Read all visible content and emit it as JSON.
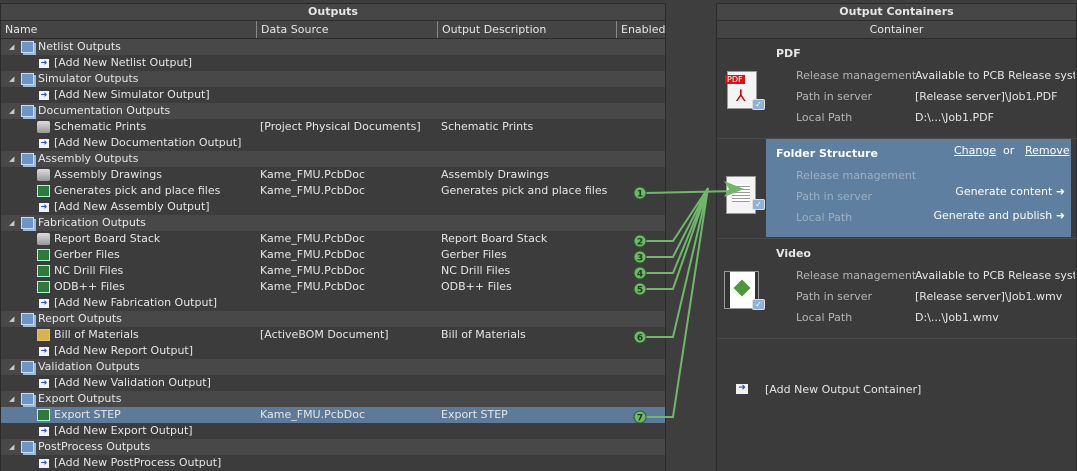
{
  "outputs": {
    "title": "Outputs",
    "columns": [
      "Name",
      "Data Source",
      "Output Description",
      "Enabled"
    ],
    "rows": [
      {
        "type": "group",
        "name": "Netlist Outputs"
      },
      {
        "type": "add",
        "name": "[Add New Netlist Output]"
      },
      {
        "type": "group",
        "name": "Simulator Outputs"
      },
      {
        "type": "add",
        "name": "[Add New Simulator Output]"
      },
      {
        "type": "group",
        "name": "Documentation Outputs"
      },
      {
        "type": "item",
        "icon": "printer-icon",
        "name": "Schematic Prints",
        "source": "[Project Physical Documents]",
        "desc": "Schematic Prints"
      },
      {
        "type": "add",
        "name": "[Add New Documentation Output]"
      },
      {
        "type": "group",
        "name": "Assembly Outputs"
      },
      {
        "type": "item",
        "icon": "printer-icon",
        "name": "Assembly Drawings",
        "source": "Kame_FMU.PcbDoc",
        "desc": "Assembly Drawings"
      },
      {
        "type": "item",
        "icon": "pcb-icon",
        "name": "Generates pick and place files",
        "source": "Kame_FMU.PcbDoc",
        "desc": "Generates pick and place files",
        "enabled": "1"
      },
      {
        "type": "add",
        "name": "[Add New Assembly Output]"
      },
      {
        "type": "group",
        "name": "Fabrication Outputs"
      },
      {
        "type": "item",
        "icon": "printer-icon",
        "name": "Report Board Stack",
        "source": "Kame_FMU.PcbDoc",
        "desc": "Report Board Stack",
        "enabled": "2"
      },
      {
        "type": "item",
        "icon": "pcb-icon",
        "name": "Gerber Files",
        "source": "Kame_FMU.PcbDoc",
        "desc": "Gerber Files",
        "enabled": "3"
      },
      {
        "type": "item",
        "icon": "pcb-icon",
        "name": "NC Drill Files",
        "source": "Kame_FMU.PcbDoc",
        "desc": "NC Drill Files",
        "enabled": "4"
      },
      {
        "type": "item",
        "icon": "pcb-icon",
        "name": "ODB++ Files",
        "source": "Kame_FMU.PcbDoc",
        "desc": "ODB++ Files",
        "enabled": "5"
      },
      {
        "type": "add",
        "name": "[Add New Fabrication Output]"
      },
      {
        "type": "group",
        "name": "Report Outputs"
      },
      {
        "type": "item",
        "icon": "bom-icon",
        "name": "Bill of Materials",
        "source": "[ActiveBOM Document]",
        "desc": "Bill of Materials",
        "enabled": "6"
      },
      {
        "type": "add",
        "name": "[Add New Report Output]"
      },
      {
        "type": "group",
        "name": "Validation Outputs"
      },
      {
        "type": "add",
        "name": "[Add New Validation Output]"
      },
      {
        "type": "group",
        "name": "Export Outputs"
      },
      {
        "type": "item",
        "icon": "pcb-icon",
        "name": "Export STEP",
        "source": "Kame_FMU.PcbDoc",
        "desc": "Export STEP",
        "enabled": "7",
        "selected": true
      },
      {
        "type": "add",
        "name": "[Add New Export Output]"
      },
      {
        "type": "group",
        "name": "PostProcess Outputs"
      },
      {
        "type": "add",
        "name": "[Add New PostProcess Output]"
      }
    ]
  },
  "containers": {
    "title": "Output Containers",
    "column": "Container",
    "labels": {
      "release": "Release management",
      "path": "Path in server",
      "local": "Local Path"
    },
    "pdf": {
      "title": "PDF",
      "icon_text": "PDF",
      "release": "Available to PCB Release system",
      "path": "[Release server]\\Job1.PDF",
      "local": "D:\\...\\Job1.PDF"
    },
    "folder": {
      "title": "Folder Structure",
      "change": "Change",
      "or": "or",
      "remove": "Remove",
      "generate": "Generate content ➜",
      "publish": "Generate and publish ➜"
    },
    "video": {
      "title": "Video",
      "release": "Available to PCB Release system",
      "path": "[Release server]\\Job1.wmv",
      "local": "D:\\...\\Job1.wmv"
    },
    "add": "[Add New Output Container]"
  },
  "colors": {
    "selected": "#5f7fa0",
    "connector": "#6fb86a"
  }
}
